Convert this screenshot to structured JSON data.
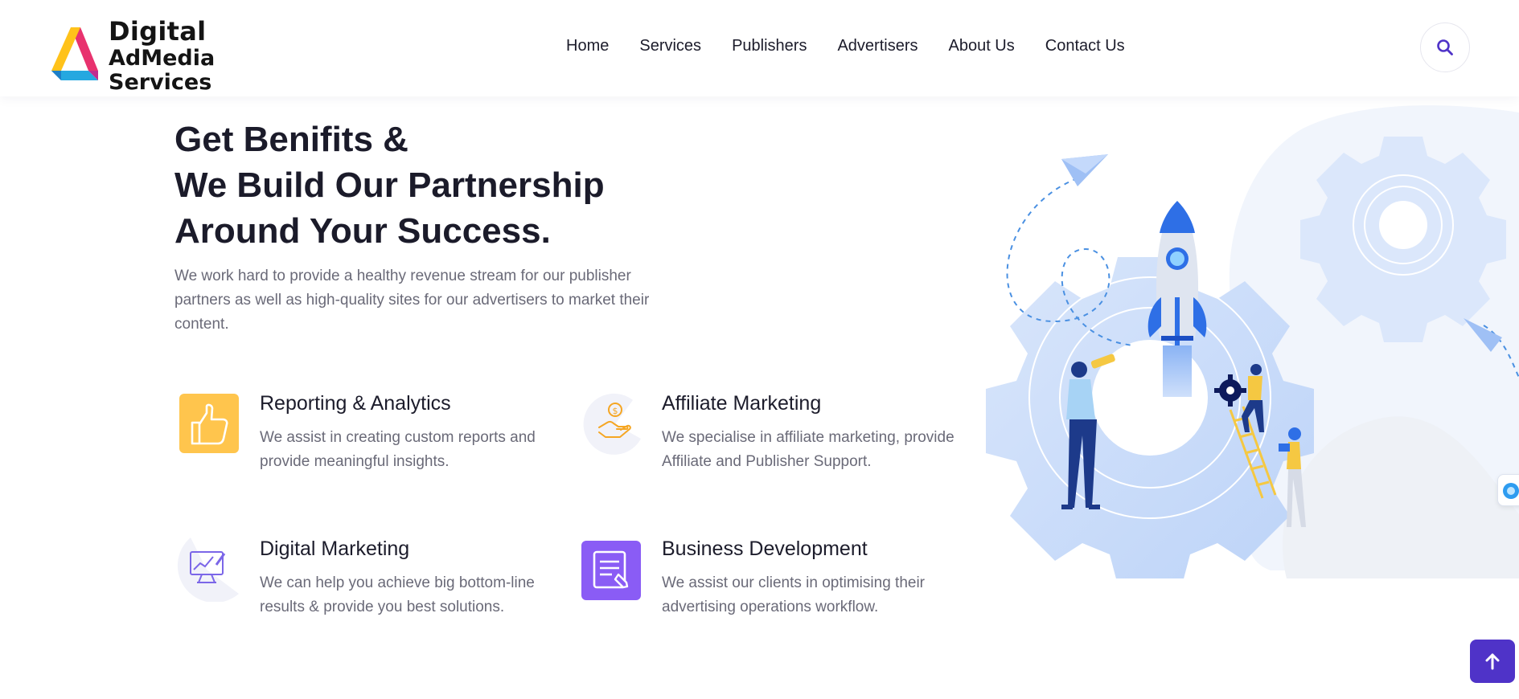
{
  "brand": {
    "line1": "Digital",
    "line2": "AdMedia Services"
  },
  "nav": {
    "items": [
      "Home",
      "Services",
      "Publishers",
      "Advertisers",
      "About Us",
      "Contact Us"
    ]
  },
  "icons": {
    "search": "search-icon",
    "scroll_top": "arrow-up-icon"
  },
  "hero": {
    "title_lines": [
      "Get Benifits &",
      "We Build Our Partnership",
      "Around Your Success."
    ],
    "description": "We work hard to provide a healthy revenue stream for our publisher partners as well as high-quality sites for our advertisers to market their content."
  },
  "features": [
    {
      "title": "Reporting & Analytics",
      "description": "We assist in creating custom reports and provide meaningful insights.",
      "icon": "thumbs-up-icon"
    },
    {
      "title": "Affiliate Marketing",
      "description": "We specialise in affiliate marketing, provide Affiliate and Publisher Support.",
      "icon": "hand-coin-icon"
    },
    {
      "title": "Digital Marketing",
      "description": "We can help you achieve big bottom-line results & provide you best solutions.",
      "icon": "monitor-chart-icon"
    },
    {
      "title": "Business Development",
      "description": "We assist our clients in optimising their advertising operations workflow.",
      "icon": "document-edit-icon"
    }
  ],
  "colors": {
    "accent": "#4f33c8",
    "feature_yellow": "#ffc54d",
    "feature_purple": "#8a5cf5",
    "text_dark": "#1c1c2b",
    "text_muted": "#6a6a78"
  }
}
